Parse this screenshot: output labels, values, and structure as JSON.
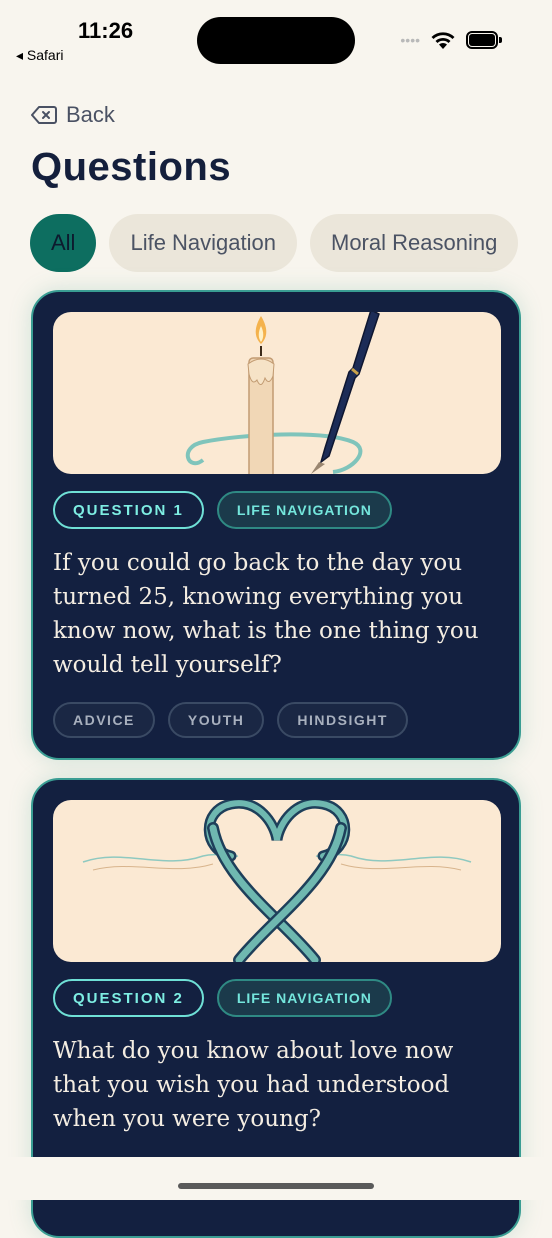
{
  "status_bar": {
    "time": "11:26",
    "back_app": "◂ Safari",
    "signal": "••••"
  },
  "header": {
    "back_label": "Back",
    "title": "Questions"
  },
  "filters": {
    "items": [
      "All",
      "Life Navigation",
      "Moral Reasoning"
    ],
    "active": "All"
  },
  "cards": [
    {
      "number_label": "QUESTION 1",
      "category": "LIFE NAVIGATION",
      "question": "If you could go back to the day you turned 25, knowing everything you know now, what is the one thing you would tell yourself?",
      "tags": [
        "ADVICE",
        "YOUTH",
        "HINDSIGHT"
      ],
      "illustration": "candle-and-pen"
    },
    {
      "number_label": "QUESTION 2",
      "category": "LIFE NAVIGATION",
      "question": "What do you know about love now that you wish you had understood when you were young?",
      "illustration": "ribbon-heart"
    }
  ],
  "colors": {
    "background": "#f8f5ee",
    "card": "#132040",
    "accent": "#0d6e60",
    "teal": "#7eeee3"
  }
}
